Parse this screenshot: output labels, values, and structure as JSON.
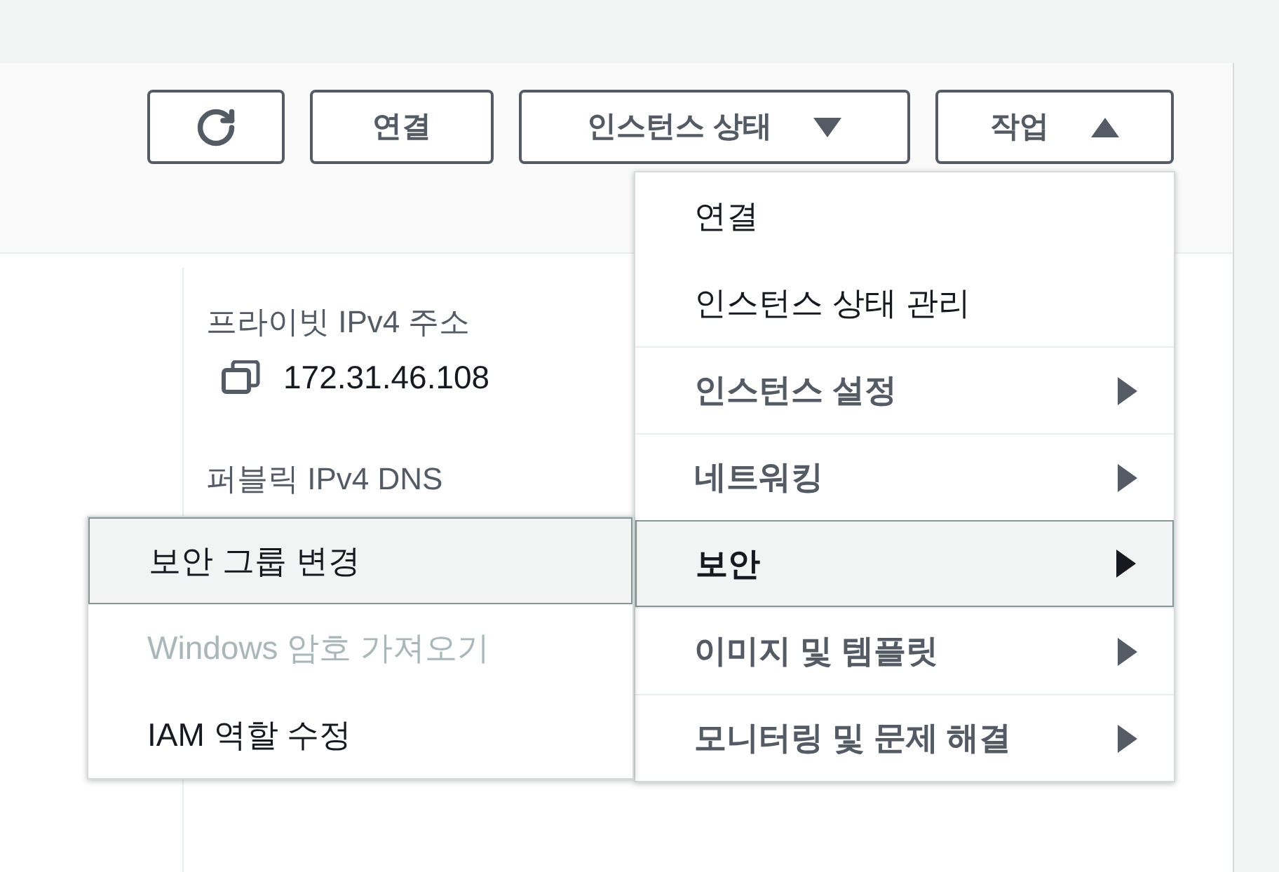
{
  "toolbar": {
    "buttons": [
      {
        "kind": "refresh"
      },
      {
        "kind": "text",
        "label": "연결"
      },
      {
        "kind": "dropdown",
        "label": "인스턴스 상태",
        "expanded": false
      },
      {
        "kind": "dropdown",
        "label": "작업",
        "expanded": true
      }
    ]
  },
  "details": [
    {
      "label": "프라이빗 IPv4 주소",
      "value": "172.31.46.108"
    },
    {
      "label": "퍼블릭 IPv4 DNS"
    }
  ],
  "actions_menu": {
    "items": [
      {
        "kind": "action",
        "label": "연결",
        "selected": false
      },
      {
        "kind": "action",
        "label": "인스턴스 상태 관리",
        "selected": false
      },
      {
        "kind": "group",
        "label": "인스턴스 설정",
        "selected": false
      },
      {
        "kind": "group",
        "label": "네트워킹",
        "selected": false
      },
      {
        "kind": "group",
        "label": "보안",
        "selected": true
      },
      {
        "kind": "group",
        "label": "이미지 및 템플릿",
        "selected": false
      },
      {
        "kind": "group",
        "label": "모니터링 및 문제 해결",
        "selected": false
      }
    ]
  },
  "submenu": {
    "items": [
      {
        "label": "보안 그룹 변경",
        "selected": true,
        "disabled": false
      },
      {
        "label": "Windows 암호 가져오기",
        "selected": false,
        "disabled": true
      },
      {
        "label": "IAM 역할 수정",
        "selected": false,
        "disabled": false
      }
    ]
  }
}
